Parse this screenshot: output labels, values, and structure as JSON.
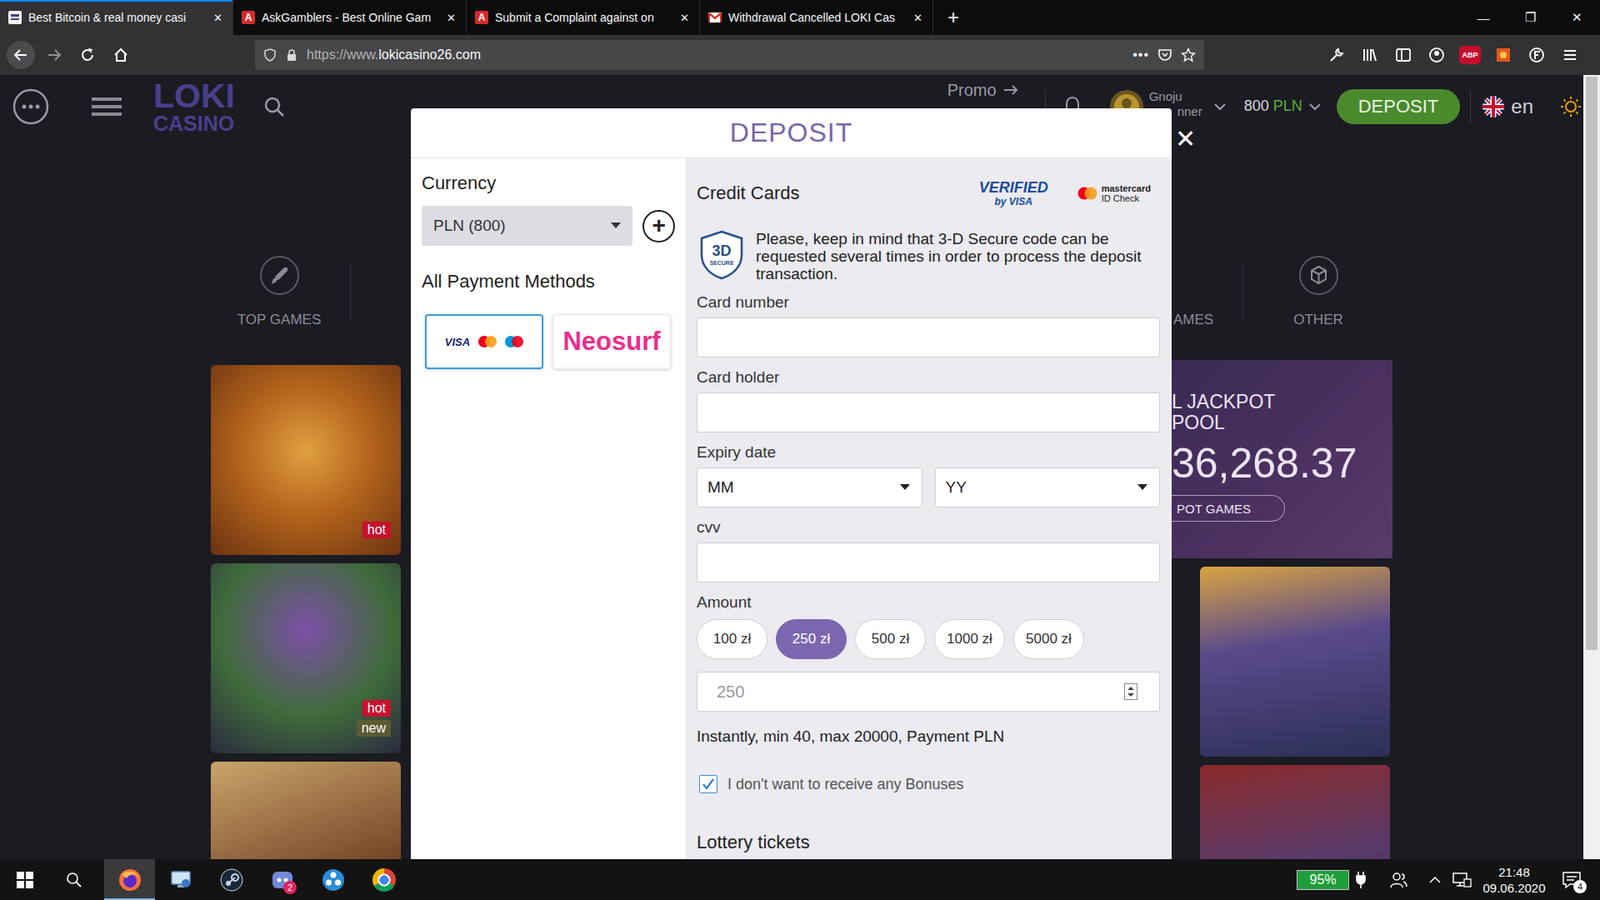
{
  "browser": {
    "tabs": [
      {
        "label": "Best Bitcoin & real money casi",
        "selected": true,
        "kind": "loki"
      },
      {
        "label": "AskGamblers - Best Online Gam",
        "selected": false,
        "kind": "askgamblers",
        "icon_text": "A"
      },
      {
        "label": "Submit a Complaint against on",
        "selected": false,
        "kind": "askgamblers",
        "icon_text": "A"
      },
      {
        "label": "Withdrawal Cancelled LOKI Cas",
        "selected": false,
        "kind": "gmail"
      }
    ],
    "tab_close": "✕",
    "new_tab": "+",
    "window_controls": [
      "—",
      "❐",
      "✕"
    ],
    "url": {
      "prefix": "https://www.",
      "domain": "lokicasino26.com"
    },
    "page_actions": "•••",
    "adblock_label": "ABP"
  },
  "site_header": {
    "logo": [
      "LOKI",
      "CASINO"
    ],
    "promo": "Promo",
    "user_name": [
      "Gnoju",
      "nner"
    ],
    "balance": {
      "amount": "800",
      "currency": "PLN"
    },
    "deposit_button": "DEPOSIT",
    "language": "en"
  },
  "categories": {
    "left": "TOP GAMES",
    "right_partial": "AMES",
    "right": "OTHER"
  },
  "game_tiles": {
    "left": [
      {
        "badges": [
          {
            "label": "hot",
            "color": "#c8102e"
          }
        ]
      },
      {
        "badges": [
          {
            "label": "hot",
            "color": "#c8102e"
          },
          {
            "label": "new",
            "color": "#5b5a32"
          }
        ]
      },
      {
        "badges": []
      }
    ],
    "right": [
      {
        "badges": []
      },
      {
        "badges": []
      }
    ]
  },
  "jackpot": {
    "title": [
      "L JACKPOT",
      "POOL"
    ],
    "amount": "36,268.37",
    "button": "POT GAMES"
  },
  "modal": {
    "title": "DEPOSIT",
    "close": "✕",
    "currency": {
      "label": "Currency",
      "value": "PLN (800)",
      "add": "+"
    },
    "payment_methods": {
      "label": "All Payment Methods",
      "items": [
        {
          "kind": "cards",
          "label": "VISA",
          "selected": true
        },
        {
          "kind": "neosurf",
          "label": "Neosurf",
          "selected": false
        }
      ]
    },
    "credit_cards": {
      "title": "Credit Cards",
      "visa_badge": [
        "VERIFIED",
        "by VISA"
      ],
      "mastercard_badge": [
        "mastercard",
        "ID Check"
      ],
      "secure_badge": [
        "3D",
        "SECURE"
      ],
      "notice": "Please, keep in mind that 3-D Secure code can be requested several times in order to process the deposit transaction."
    },
    "card_number": {
      "label": "Card number"
    },
    "card_holder": {
      "label": "Card holder"
    },
    "expiry": {
      "label": "Expiry date",
      "month": "MM",
      "year": "YY"
    },
    "cvv": {
      "label": "cvv"
    },
    "amount": {
      "label": "Amount",
      "options": [
        {
          "label": "100 zł",
          "selected": false
        },
        {
          "label": "250 zł",
          "selected": true
        },
        {
          "label": "500 zł",
          "selected": false
        },
        {
          "label": "1000 zł",
          "selected": false
        },
        {
          "label": "5000 zł",
          "selected": false
        }
      ],
      "placeholder": "250",
      "note": "Instantly, min 40, max 20000, Payment PLN"
    },
    "no_bonus": {
      "label": "I don't want to receive any Bonuses",
      "checked": true
    },
    "lottery_title": "Lottery tickets"
  },
  "taskbar": {
    "apps": [
      {
        "kind": "firefox",
        "selected": true
      },
      {
        "kind": "explorer",
        "selected": false
      },
      {
        "kind": "steam",
        "selected": false
      },
      {
        "kind": "discord",
        "selected": false,
        "badge": "2"
      },
      {
        "kind": "app",
        "selected": false
      },
      {
        "kind": "chrome",
        "selected": false
      }
    ],
    "battery": "95%",
    "time": "21:48",
    "date": "09.06.2020",
    "notifications": "4"
  }
}
